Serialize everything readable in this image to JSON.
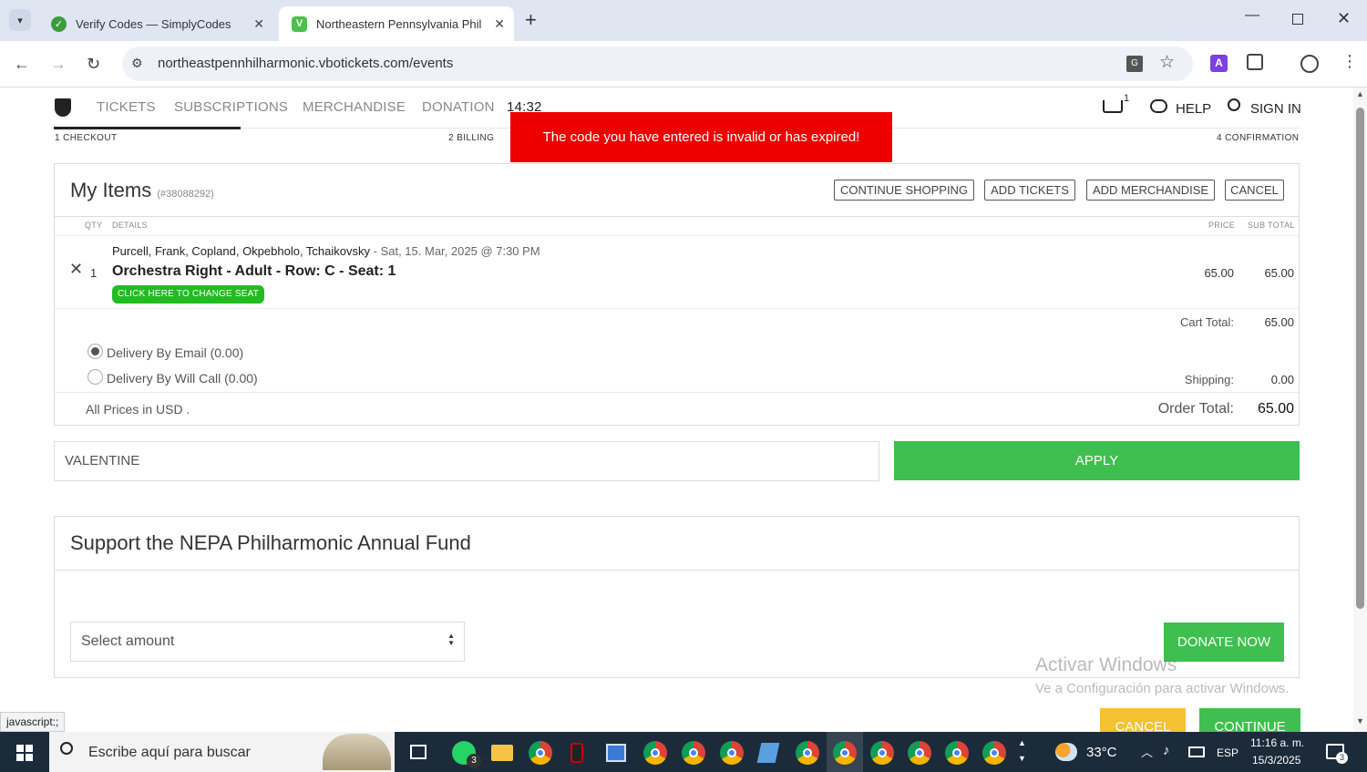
{
  "browser": {
    "tabs": [
      {
        "title": "Verify Codes — SimplyCodes",
        "fav": "✓",
        "fav_color": "#3a9d3a"
      },
      {
        "title": "Northeastern Pennsylvania Phil",
        "fav": "V",
        "fav_color": "#4cc04c"
      }
    ],
    "new_tab": "+",
    "url": "northeastpennhilharmonic.vbotickets.com/events",
    "status_text": "javascript:;"
  },
  "site": {
    "nav": [
      "TICKETS",
      "SUBSCRIPTIONS",
      "MERCHANDISE",
      "DONATION"
    ],
    "timer": "14:32",
    "cart_count": "1",
    "help": "HELP",
    "sign_in": "SIGN IN",
    "steps": [
      "1 CHECKOUT",
      "2 BILLING",
      "4 CONFIRMATION"
    ],
    "error": "The code you have entered is invalid or has expired!"
  },
  "cart": {
    "title": "My Items",
    "order_id": "(#38088292)",
    "buttons": [
      "CONTINUE SHOPPING",
      "ADD TICKETS",
      "ADD MERCHANDISE",
      "CANCEL"
    ],
    "headers": {
      "qty": "QTY",
      "details": "DETAILS",
      "price": "PRICE",
      "subtotal": "SUB TOTAL"
    },
    "item": {
      "event": "Purcell, Frank, Copland, Okpebholo, Tchaikovsky",
      "date": " - Sat, 15. Mar, 2025 @ 7:30 PM",
      "qty": "1",
      "name": "Orchestra Right - Adult - Row: C - Seat: 1",
      "change_seat": "CLICK HERE TO CHANGE SEAT",
      "price": "65.00",
      "subtotal": "65.00"
    },
    "cart_total_label": "Cart Total:",
    "cart_total": "65.00",
    "delivery": [
      "Delivery By Email (0.00)",
      "Delivery By Will Call (0.00)"
    ],
    "shipping_label": "Shipping:",
    "shipping": "0.00",
    "currency_note": "All Prices in USD .",
    "order_total_label": "Order Total:",
    "order_total": "65.00"
  },
  "promo": {
    "value": "VALENTINE",
    "apply": "APPLY"
  },
  "donation": {
    "title": "Support the NEPA Philharmonic Annual Fund",
    "select": "Select amount",
    "donate": "DONATE NOW"
  },
  "footer_buttons": {
    "cancel": "CANCEL",
    "continue": "CONTINUE"
  },
  "watermark": {
    "title": "Activar Windows",
    "subtitle": "Ve a Configuración para activar Windows."
  },
  "taskbar": {
    "search": "Escribe aquí para buscar",
    "whatsapp_badge": "3",
    "temp": "33°C",
    "lang": "ESP",
    "time": "11:16 a. m.",
    "date": "15/3/2025",
    "notif": "3"
  },
  "colors": {
    "green": "#3fbf4f",
    "error_red": "#ee0000",
    "yellow": "#f2c230"
  }
}
